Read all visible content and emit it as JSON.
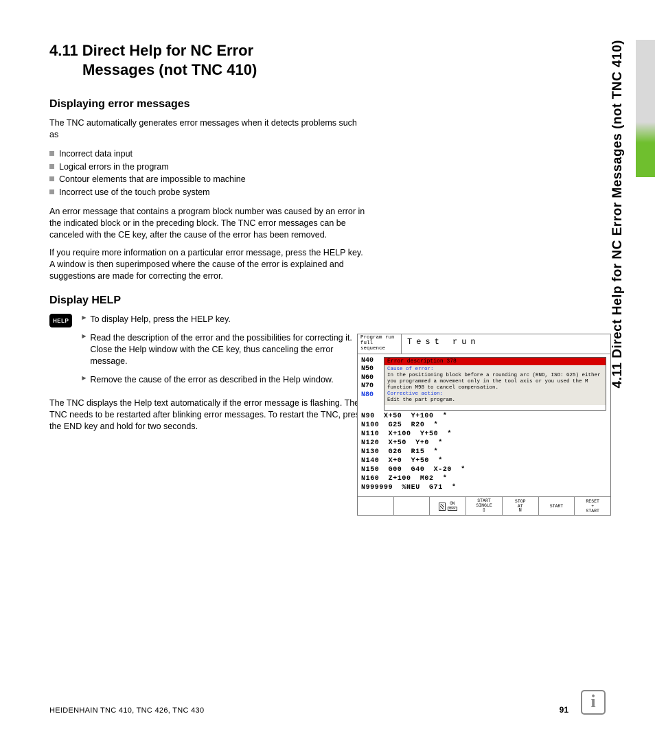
{
  "heading": {
    "num": "4.11",
    "line1": "Direct Help for NC Error",
    "line2": "Messages (not TNC 410)"
  },
  "side_tab": "4.11 Direct Help for NC Error Messages (not TNC 410)",
  "section1": {
    "title": "Displaying error messages",
    "intro": "The TNC automatically generates error messages when it detects problems such as",
    "bullets": [
      "Incorrect data input",
      "Logical errors in the program",
      "Contour elements that are impossible to machine",
      "Incorrect use of the touch probe system"
    ],
    "para2": "An error message that contains a program block number was caused by an error in the indicated block or in the preceding block. The TNC error messages can be canceled with the CE key, after the cause of the error has been removed.",
    "para3": "If you require more information on a particular error message, press the HELP key. A window is then superimposed where the cause of the error is explained and suggestions are made for correcting the error."
  },
  "section2": {
    "title": "Display HELP",
    "key_label": "HELP",
    "steps": [
      "To display Help, press the HELP key.",
      "Read the description of the error and the possibilities for correcting it. Close the Help window with the CE key, thus canceling the error message.",
      "Remove the cause of the error as described in the Help window."
    ],
    "para": "The TNC displays the Help text automatically if the error message is flashing. The TNC needs to be restarted after blinking error messages. To restart the TNC, press the END key and hold for two seconds."
  },
  "tnc": {
    "header_left": "Program run\nfull sequence",
    "header_right": "Test run",
    "left_nums": [
      "N40",
      "N50",
      "N60",
      "N70",
      "N80"
    ],
    "err_title": "Error description  378",
    "err_cause_label": "Cause of error:",
    "err_cause": "In the positioning block before a rounding arc (RND, ISO: G25) either you programmed a movement only in the tool axis or you used the M function M98 to cancel compensation.",
    "err_action_label": "Corrective action:",
    "err_action": "Edit the part program.",
    "program": "N90  X+50  Y+100  *\nN100  G25  R20  *\nN110  X+100  Y+50  *\nN120  X+50  Y+0  *\nN130  G26  R15  *\nN140  X+0  Y+50  *\nN150  G00  G40  X-20  *\nN160  Z+100  M02  *\nN999999  %NEU  G71  *",
    "softkeys": {
      "on": "ON",
      "off": "OFF",
      "start_single": "START\nSINGLE",
      "stop_at": "STOP\nAT",
      "start": "START",
      "reset_start": "RESET\n+\nSTART"
    }
  },
  "footer": {
    "left": "HEIDENHAIN TNC 410, TNC 426, TNC 430",
    "page": "91"
  }
}
